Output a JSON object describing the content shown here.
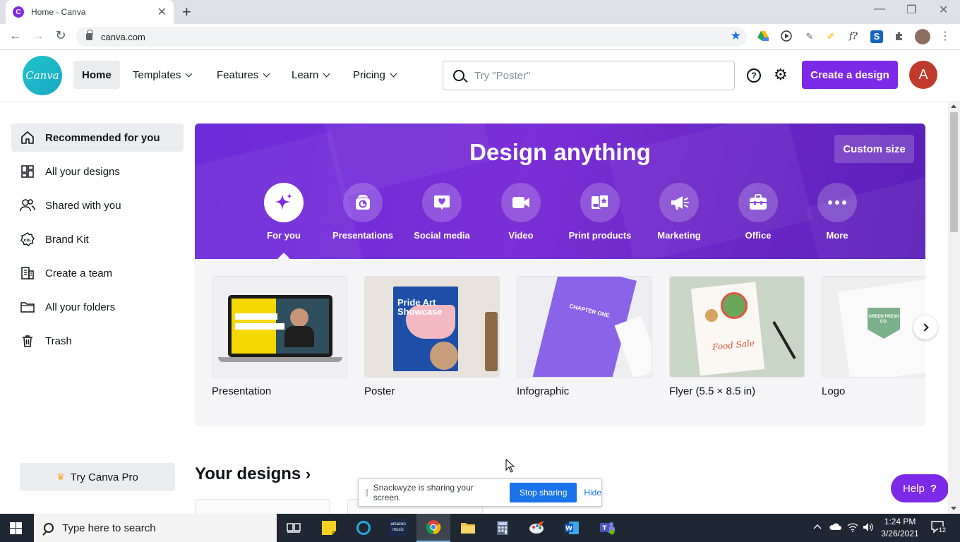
{
  "browser": {
    "tab_title": "Home - Canva",
    "favicon_letter": "C",
    "url": "canva.com"
  },
  "header": {
    "logo_text": "Canva",
    "nav": [
      {
        "label": "Home"
      },
      {
        "label": "Templates"
      },
      {
        "label": "Features"
      },
      {
        "label": "Learn"
      },
      {
        "label": "Pricing"
      }
    ],
    "search_placeholder": "Try \"Poster\"",
    "create_label": "Create a design",
    "avatar_letter": "A",
    "help_glyph": "?"
  },
  "sidebar": {
    "items": [
      {
        "label": "Recommended for you",
        "icon": "home-icon"
      },
      {
        "label": "All your designs",
        "icon": "grid-icon"
      },
      {
        "label": "Shared with you",
        "icon": "people-icon"
      },
      {
        "label": "Brand Kit",
        "icon": "brand-kit-icon"
      },
      {
        "label": "Create a team",
        "icon": "building-icon"
      },
      {
        "label": "All your folders",
        "icon": "folder-icon"
      },
      {
        "label": "Trash",
        "icon": "trash-icon"
      }
    ],
    "try_pro": "Try Canva Pro"
  },
  "hero": {
    "title": "Design anything",
    "custom_size": "Custom size",
    "categories": [
      {
        "label": "For you",
        "icon": "sparkle-icon"
      },
      {
        "label": "Presentations",
        "icon": "presentation-icon"
      },
      {
        "label": "Social media",
        "icon": "heart-bubble-icon"
      },
      {
        "label": "Video",
        "icon": "video-camera-icon"
      },
      {
        "label": "Print products",
        "icon": "print-icon"
      },
      {
        "label": "Marketing",
        "icon": "megaphone-icon"
      },
      {
        "label": "Office",
        "icon": "briefcase-icon"
      },
      {
        "label": "More",
        "icon": "more-dots-icon"
      }
    ]
  },
  "templates": [
    {
      "name": "Presentation"
    },
    {
      "name": "Poster",
      "thumb_text": "Pride Art Showcase"
    },
    {
      "name": "Infographic",
      "thumb_text": "CHAPTER ONE"
    },
    {
      "name": "Flyer (5.5 × 8.5 in)",
      "thumb_text": "Food Sale"
    },
    {
      "name": "Logo",
      "thumb_text": "GREEN FRESH CO."
    }
  ],
  "your_designs": {
    "title": "Your designs",
    "arrow": "›"
  },
  "share_bar": {
    "message": "Snackwyze is sharing your screen.",
    "stop_label": "Stop sharing",
    "hide_label": "Hide"
  },
  "help_button": {
    "label": "Help",
    "glyph": "?"
  },
  "taskbar": {
    "search_placeholder": "Type here to search",
    "time": "1:24 PM",
    "date": "3/26/2021",
    "notification_count": "12",
    "apps": [
      "task-view-icon",
      "sticky-notes-icon",
      "cortana-icon",
      "amazon-music-icon",
      "chrome-icon",
      "file-explorer-icon",
      "calculator-icon",
      "paint-icon",
      "word-icon",
      "teams-icon"
    ]
  },
  "colors": {
    "brand_purple": "#7d2ae8",
    "canva_teal": "#20c4cb",
    "avatar_red": "#c0392b"
  }
}
